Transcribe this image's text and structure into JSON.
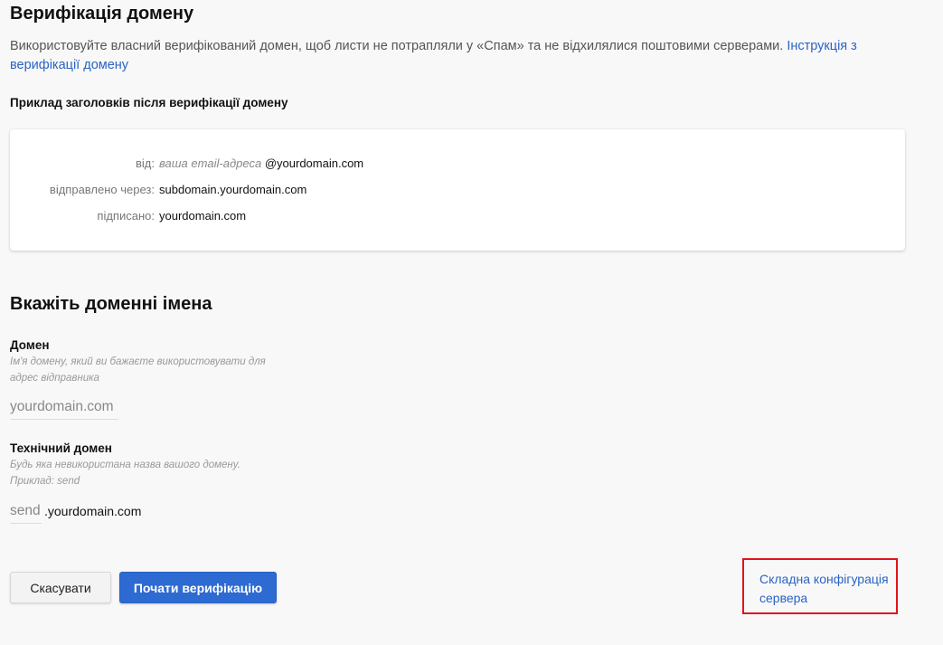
{
  "verification": {
    "title": "Верифікація домену",
    "description": "Використовуйте власний верифікований домен, щоб листи не потрапляли у «Спам» та не відхилялися поштовими серверами.",
    "instruction_link": "Інструкція з верифікації домену",
    "example_title": "Приклад заголовків після верифікації домену",
    "headers": {
      "from_label": "від:",
      "from_placeholder": "ваша email-адреса",
      "from_domain": "@yourdomain.com",
      "sent_via_label": "відправлено через:",
      "sent_via_value": "subdomain.yourdomain.com",
      "signed_label": "підписано:",
      "signed_value": "yourdomain.com"
    }
  },
  "domains": {
    "title": "Вкажіть доменні імена",
    "domain_field": {
      "label": "Домен",
      "hint": "Ім'я домену, який ви бажаєте використовувати для адрес відправника",
      "placeholder": "yourdomain.com",
      "value": ""
    },
    "tech_domain_field": {
      "label": "Технічний домен",
      "hint": "Будь яка невикористана назва вашого домену. Приклад: send",
      "placeholder": "send",
      "value": "",
      "suffix": ".yourdomain.com"
    }
  },
  "actions": {
    "cancel_label": "Скасувати",
    "start_label": "Почати верифікацію",
    "advanced_link": "Складна конфігурація сервера"
  },
  "colors": {
    "accent": "#2d6ad1",
    "link": "#2a63c5",
    "highlight_border": "#e0141b"
  }
}
